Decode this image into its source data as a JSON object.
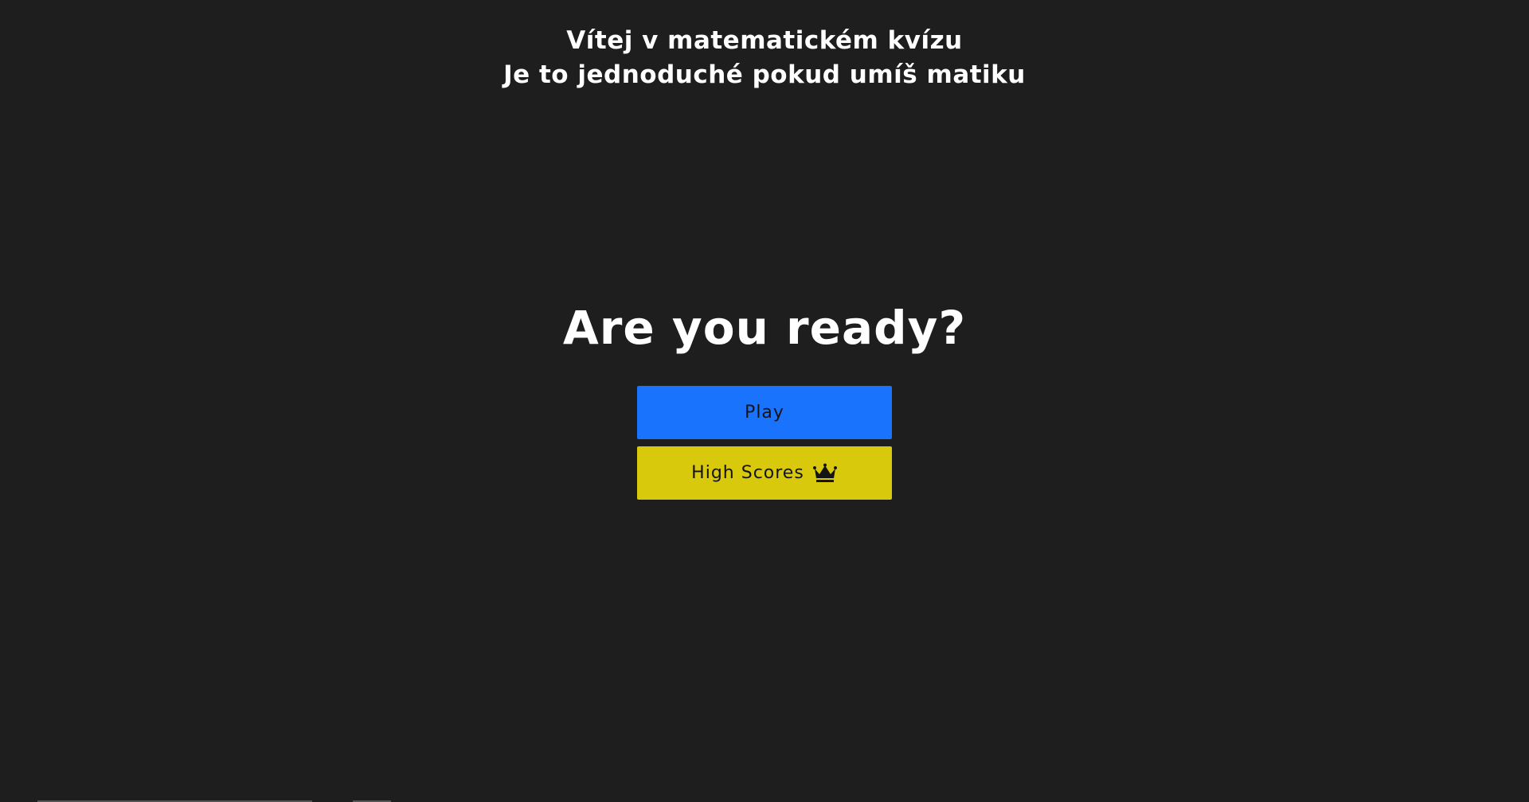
{
  "header": {
    "line1": "Vítej v matematickém kvízu",
    "line2": "Je to jednoduché pokud umíš matiku"
  },
  "main": {
    "title": "Are you ready?",
    "play_label": "Play",
    "high_scores_label": "High Scores",
    "high_scores_icon": "crown-icon"
  },
  "colors": {
    "background": "#1e1e1e",
    "play_button": "#1a73fc",
    "high_scores_button": "#d9c90c",
    "text": "#ffffff",
    "button_text": "#141414"
  }
}
